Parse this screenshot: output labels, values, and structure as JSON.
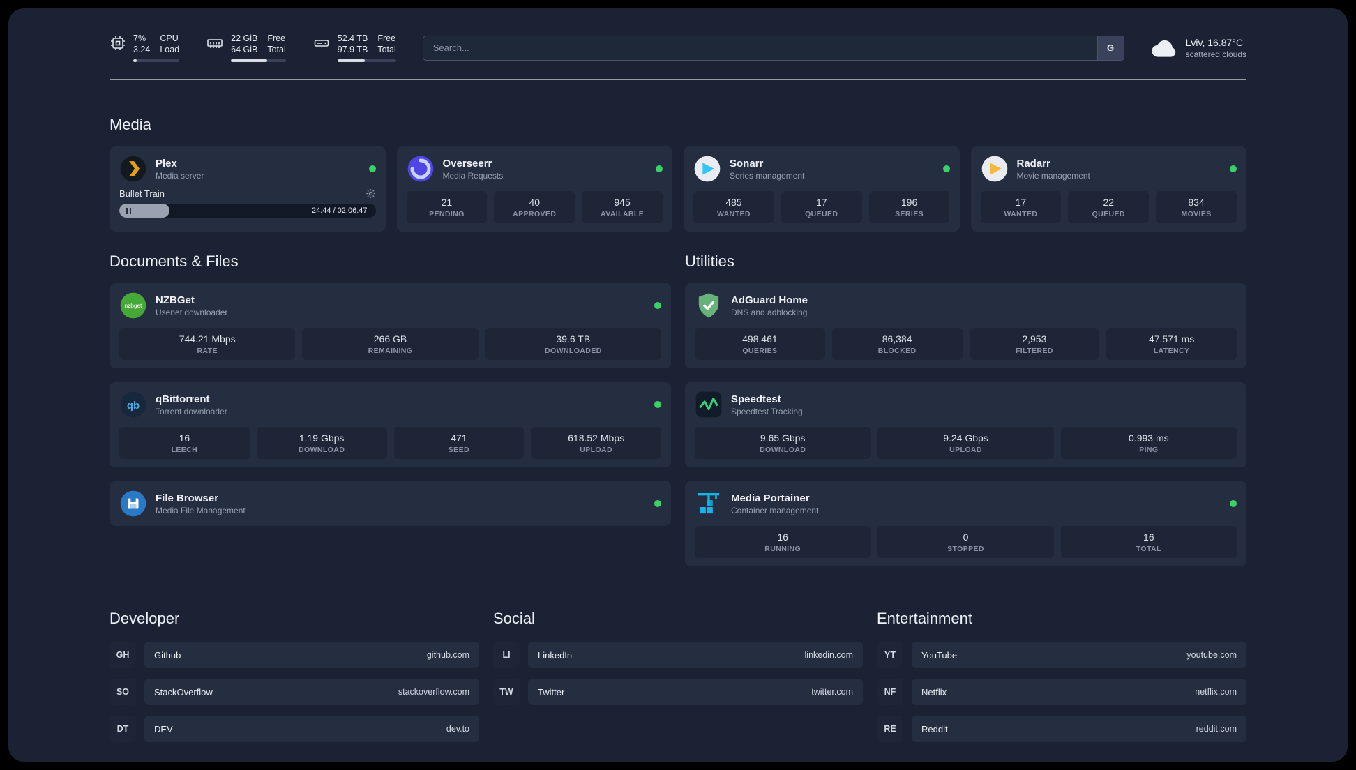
{
  "topbar": {
    "cpu": {
      "line1_value": "7%",
      "line1_label": "CPU",
      "line2_value": "3.24",
      "line2_label": "Load",
      "bar_pct": 7
    },
    "ram": {
      "line1_value": "22 GiB",
      "line1_label": "Free",
      "line2_value": "64 GiB",
      "line2_label": "Total",
      "bar_pct": 66
    },
    "disk": {
      "line1_value": "52.4 TB",
      "line1_label": "Free",
      "line2_value": "97.9 TB",
      "line2_label": "Total",
      "bar_pct": 47
    },
    "search": {
      "placeholder": "Search...",
      "engine_label": "G"
    },
    "weather": {
      "location": "Lviv, 16.87°C",
      "condition": "scattered clouds"
    }
  },
  "media": {
    "title": "Media",
    "plex": {
      "name": "Plex",
      "subtitle": "Media server",
      "now_playing": "Bullet Train",
      "time": "24:44 / 02:06:47",
      "progress_pct": 19.5
    },
    "overseerr": {
      "name": "Overseerr",
      "subtitle": "Media Requests",
      "stats": [
        {
          "value": "21",
          "label": "PENDING"
        },
        {
          "value": "40",
          "label": "APPROVED"
        },
        {
          "value": "945",
          "label": "AVAILABLE"
        }
      ]
    },
    "sonarr": {
      "name": "Sonarr",
      "subtitle": "Series management",
      "stats": [
        {
          "value": "485",
          "label": "WANTED"
        },
        {
          "value": "17",
          "label": "QUEUED"
        },
        {
          "value": "196",
          "label": "SERIES"
        }
      ]
    },
    "radarr": {
      "name": "Radarr",
      "subtitle": "Movie management",
      "stats": [
        {
          "value": "17",
          "label": "WANTED"
        },
        {
          "value": "22",
          "label": "QUEUED"
        },
        {
          "value": "834",
          "label": "MOVIES"
        }
      ]
    }
  },
  "documents": {
    "title": "Documents & Files",
    "nzbget": {
      "name": "NZBGet",
      "subtitle": "Usenet downloader",
      "stats": [
        {
          "value": "744.21 Mbps",
          "label": "RATE"
        },
        {
          "value": "266 GB",
          "label": "REMAINING"
        },
        {
          "value": "39.6 TB",
          "label": "DOWNLOADED"
        }
      ]
    },
    "qbittorrent": {
      "name": "qBittorrent",
      "subtitle": "Torrent downloader",
      "stats": [
        {
          "value": "16",
          "label": "LEECH"
        },
        {
          "value": "1.19 Gbps",
          "label": "DOWNLOAD"
        },
        {
          "value": "471",
          "label": "SEED"
        },
        {
          "value": "618.52 Mbps",
          "label": "UPLOAD"
        }
      ]
    },
    "filebrowser": {
      "name": "File Browser",
      "subtitle": "Media File Management"
    }
  },
  "utilities": {
    "title": "Utilities",
    "adguard": {
      "name": "AdGuard Home",
      "subtitle": "DNS and adblocking",
      "stats": [
        {
          "value": "498,461",
          "label": "QUERIES"
        },
        {
          "value": "86,384",
          "label": "BLOCKED"
        },
        {
          "value": "2,953",
          "label": "FILTERED"
        },
        {
          "value": "47.571 ms",
          "label": "LATENCY"
        }
      ]
    },
    "speedtest": {
      "name": "Speedtest",
      "subtitle": "Speedtest Tracking",
      "stats": [
        {
          "value": "9.65 Gbps",
          "label": "DOWNLOAD"
        },
        {
          "value": "9.24 Gbps",
          "label": "UPLOAD"
        },
        {
          "value": "0.993 ms",
          "label": "PING"
        }
      ]
    },
    "portainer": {
      "name": "Media Portainer",
      "subtitle": "Container management",
      "stats": [
        {
          "value": "16",
          "label": "RUNNING"
        },
        {
          "value": "0",
          "label": "STOPPED"
        },
        {
          "value": "16",
          "label": "TOTAL"
        }
      ]
    }
  },
  "links": {
    "developer": {
      "title": "Developer",
      "items": [
        {
          "abbr": "GH",
          "name": "Github",
          "url": "github.com"
        },
        {
          "abbr": "SO",
          "name": "StackOverflow",
          "url": "stackoverflow.com"
        },
        {
          "abbr": "DT",
          "name": "DEV",
          "url": "dev.to"
        }
      ]
    },
    "social": {
      "title": "Social",
      "items": [
        {
          "abbr": "LI",
          "name": "LinkedIn",
          "url": "linkedin.com"
        },
        {
          "abbr": "TW",
          "name": "Twitter",
          "url": "twitter.com"
        }
      ]
    },
    "entertainment": {
      "title": "Entertainment",
      "items": [
        {
          "abbr": "YT",
          "name": "YouTube",
          "url": "youtube.com"
        },
        {
          "abbr": "NF",
          "name": "Netflix",
          "url": "netflix.com"
        },
        {
          "abbr": "RE",
          "name": "Reddit",
          "url": "reddit.com"
        }
      ]
    }
  },
  "colors": {
    "status_online": "#3bd167",
    "plex_accent": "#e5a00d",
    "radarr_accent": "#f4b740",
    "sonarr_accent": "#35c5f4",
    "nzbget_accent": "#46a836",
    "qbittorrent_accent": "#4fa8e0",
    "adguard_accent": "#67b279",
    "speedtest_accent": "#34d27b",
    "portainer_accent": "#13b5ea"
  }
}
